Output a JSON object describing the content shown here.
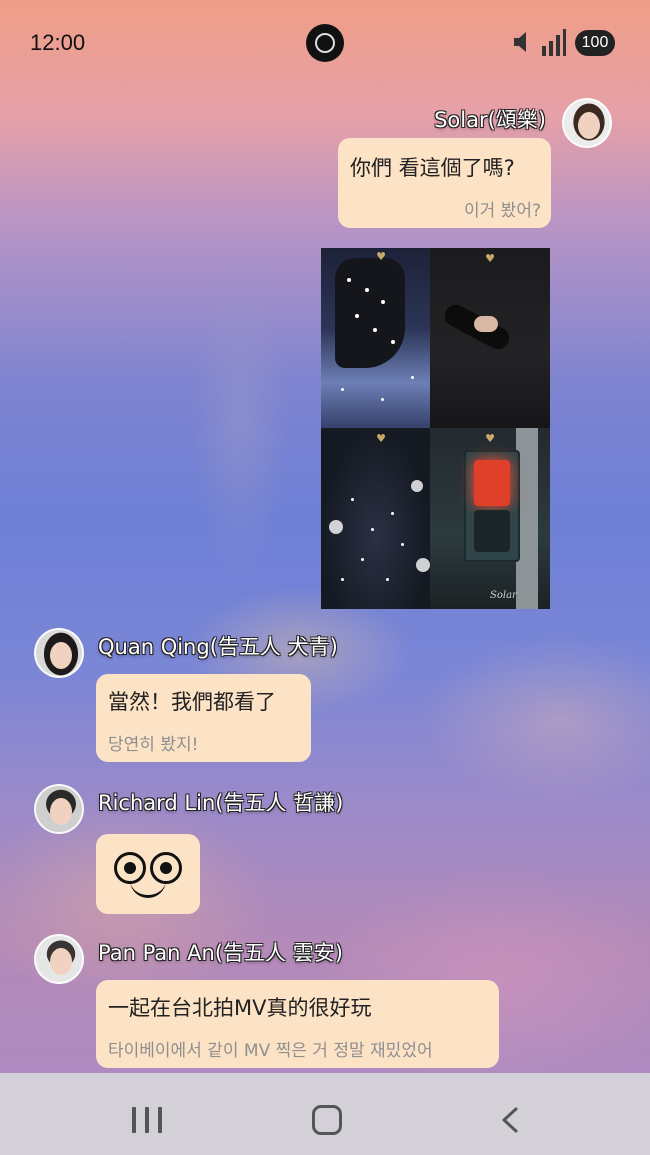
{
  "status_bar": {
    "time": "12:00",
    "battery": "100",
    "icons": [
      "camera-icon",
      "mute-icon",
      "signal-icon",
      "battery-icon"
    ]
  },
  "messages": [
    {
      "sender": "Solar(頌樂)",
      "avatar": "avatar-solar",
      "text": "你們 看這個了嗎?",
      "translation": "이거 봤어?",
      "image": {
        "watermark": "Solar"
      }
    },
    {
      "sender": "Quan Qing(告五人 犬青)",
      "avatar": "avatar-quan-qing",
      "text": "當然！我們都看了",
      "translation": "당연히 봤지!"
    },
    {
      "sender": "Richard Lin(告五人 哲謙)",
      "avatar": "avatar-richard-lin",
      "emoji": "smiling-face-sticker"
    },
    {
      "sender": "Pan Pan An(告五人 雲安)",
      "avatar": "avatar-pan-pan-an",
      "text": "一起在台北拍MV真的很好玩",
      "translation": "타이베이에서 같이 MV 찍은 거 정말 재밌었어"
    }
  ],
  "nav_bar": {
    "buttons": [
      "recents-icon",
      "home-icon",
      "back-icon"
    ]
  },
  "colors": {
    "bubble": "#fde3c6",
    "name_text": "#ffffff",
    "translation_text": "#8f8f8f",
    "nav_background": "#d4d0d7"
  }
}
